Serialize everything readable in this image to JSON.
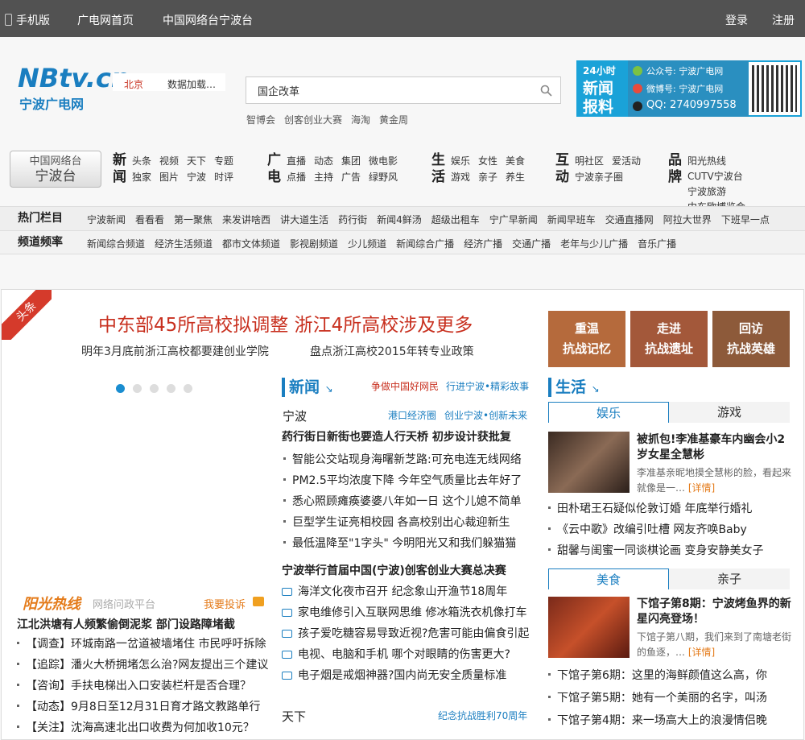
{
  "topbar": {
    "mobile": "手机版",
    "home": "广电网首页",
    "cntv": "中国网络台宁波台",
    "login": "登录",
    "register": "注册"
  },
  "logo": {
    "brand": "NBtv.cn",
    "name": "宁波广电网"
  },
  "city": {
    "name": "北京",
    "loading": "数据加载…"
  },
  "search": {
    "value": "国企改革",
    "hotwords": [
      "智博会",
      "创客创业大赛",
      "海淘",
      "黄金周"
    ]
  },
  "baoliao": {
    "line1": "24小时",
    "line2": "新闻",
    "line3": "报料",
    "wechat": "公众号: 宁波广电网",
    "weibo": "微博号: 宁波广电网",
    "qq": "QQ: 2740997558"
  },
  "cntv_badge": {
    "line1": "中国网络台",
    "line2": "宁波台"
  },
  "nav": [
    {
      "big": "新闻",
      "rows": [
        [
          "头条",
          "视频",
          "天下",
          "专题"
        ],
        [
          "独家",
          "图片",
          "宁波",
          "时评"
        ]
      ]
    },
    {
      "big": "广电",
      "rows": [
        [
          "直播",
          "动态",
          "集团",
          "微电影"
        ],
        [
          "点播",
          "主持",
          "广告",
          "绿野风"
        ]
      ]
    },
    {
      "big": "生活",
      "rows": [
        [
          "娱乐",
          "女性",
          "美食"
        ],
        [
          "游戏",
          "亲子",
          "养生"
        ]
      ]
    },
    {
      "big": "互动",
      "rows": [
        [
          "明社区",
          "爱活动"
        ],
        [
          "宁波亲子圈"
        ]
      ]
    },
    {
      "big": "品牌",
      "rows": [
        [
          "阳光热线"
        ],
        [
          "CUTV宁波台"
        ],
        [
          "宁波旅游"
        ],
        [
          "中东欧博览会"
        ]
      ]
    }
  ],
  "hot": {
    "title": "热门栏目",
    "items": [
      "宁波新闻",
      "看看看",
      "第一聚焦",
      "来发讲啥西",
      "讲大道生活",
      "药行街",
      "新闻4鲜汤",
      "超级出租车",
      "宁广早新闻",
      "新闻早班车",
      "交通直播网",
      "阿拉大世界",
      "下班早一点"
    ]
  },
  "channels": {
    "title": "频道频率",
    "items": [
      "新闻综合频道",
      "经济生活频道",
      "都市文体频道",
      "影视剧频道",
      "少儿频道",
      "新闻综合广播",
      "经济广播",
      "交通广播",
      "老年与少儿广播",
      "音乐广播"
    ]
  },
  "main": {
    "ribbon": "头条",
    "headline": "中东部45所高校拟调整 浙江4所高校涉及更多",
    "sub1": "明年3月底前浙江高校都要建创业学院",
    "sub2": "盘点浙江高校2015年转专业政策",
    "sunline": {
      "logo": "阳光热线",
      "platform": "网络问政平台",
      "complain": "我要投诉"
    },
    "sun_bold": "江北洪塘有人频繁偷倒泥浆  部门设路障堵截",
    "sun_list": [
      "【调查】环城南路一岔道被墙堵住 市民呼吁拆除",
      "【追踪】潘火大桥拥堵怎么治?网友提出三个建议",
      "【咨询】手扶电梯出入口安装栏杆是否合理？",
      "【动态】9月8日至12月31日育才路文教路单行",
      "【关注】沈海高速北出口收费为何加收10元？"
    ],
    "news": {
      "title": "新闻",
      "tag1": "争做中国好网民",
      "tag2": "行进宁波•精彩故事",
      "ningbo": "宁波",
      "tag3": "港口经济圈",
      "tag4": "创业宁波•创新未来",
      "bold1": "药行街日新街也要造人行天桥  初步设计获批复",
      "list1": [
        "智能公交站现身海曙新芝路:可充电连无线网络",
        "PM2.5平均浓度下降  今年空气质量比去年好了",
        "悉心照顾瘫痪婆婆八年如一日  这个儿媳不简单",
        "巨型学生证亮相校园  各高校别出心裁迎新生",
        "最低温降至\"1字头\" 今明阳光又和我们躲猫猫"
      ],
      "bold2": "宁波举行首届中国(宁波)创客创业大赛总决赛",
      "list2": [
        "海洋文化夜市召开  纪念象山开渔节18周年",
        "家电维修引入互联网思维  修冰箱洗衣机像打车",
        "孩子爱吃糖容易导致近视?危害可能由偏食引起",
        "电视、电脑和手机  哪个对眼睛的伤害更大?",
        "电子烟是戒烟神器?国内尚无安全质量标准"
      ],
      "tianxia": "天下",
      "tag5": "纪念抗战胜利70周年"
    },
    "banners": [
      "重温\n抗战记忆",
      "走进\n抗战遗址",
      "回访\n抗战英雄"
    ],
    "life": {
      "title": "生活",
      "tabs1": [
        "娱乐",
        "游戏"
      ],
      "feat1_title": "被抓包!李准基豪车内幽会小2岁女星全慧彬",
      "feat1_desc": "李准基亲昵地摸全慧彬的脸，看起来就像是一…",
      "detail": "[详情]",
      "list1": [
        "田朴珺王石疑似伦敦订婚  年底举行婚礼",
        "《云中歌》改编引吐槽  网友齐唤Baby",
        "甜馨与闺蜜一同谈棋论画  变身安静美女子"
      ],
      "tabs2": [
        "美食",
        "亲子"
      ],
      "feat2_title": "下馆子第8期：宁波烤鱼界的新星闪亮登场！",
      "feat2_desc": "下馆子第八期，我们来到了南塘老街的鱼逐，…",
      "list2": [
        "下馆子第6期：这里的海鲜颜值这么高，你",
        "下馆子第5期：她有一个美丽的名字，叫汤",
        "下馆子第4期：来一场高大上的浪漫情侣晚"
      ]
    }
  },
  "colors": {
    "accent": "#1a7ec0",
    "headline": "#c8301f",
    "topbar": "#525252",
    "baoliao": "#1aa2d8"
  }
}
